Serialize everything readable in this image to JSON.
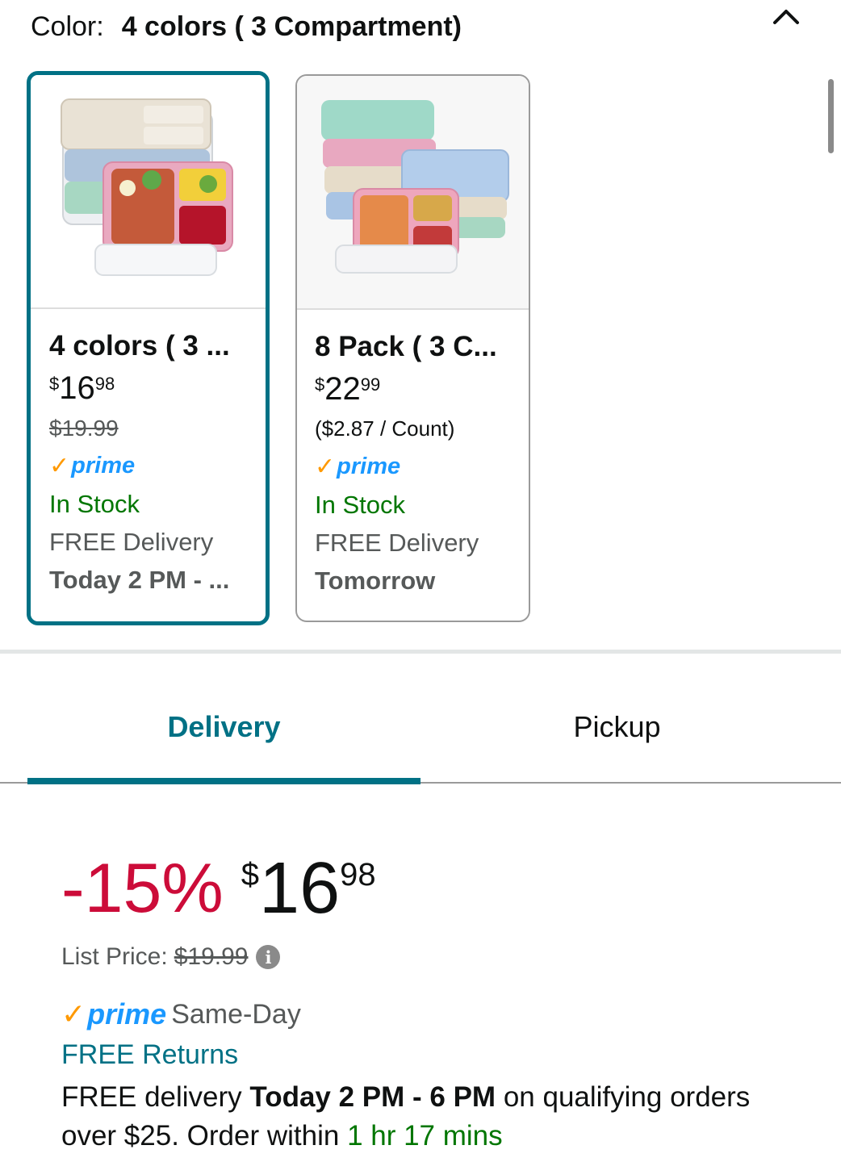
{
  "color_selector": {
    "label": "Color:",
    "selected_value": "4 colors ( 3 Compartment)",
    "collapse_icon": "chevron-up-icon"
  },
  "swatches": [
    {
      "title": "4 colors ( 3 ...",
      "price_currency": "$",
      "price_whole": "16",
      "price_fraction": "98",
      "secondary": "$19.99",
      "prime": "prime",
      "stock": "In Stock",
      "delivery_label": "FREE Delivery",
      "delivery_date": "Today 2 PM - ...",
      "selected": true
    },
    {
      "title": "8 Pack ( 3 C...",
      "price_currency": "$",
      "price_whole": "22",
      "price_fraction": "99",
      "secondary": "($2.87 / Count)",
      "prime": "prime",
      "stock": "In Stock",
      "delivery_label": "FREE Delivery",
      "delivery_date": "Tomorrow",
      "selected": false
    }
  ],
  "tabs": [
    {
      "label": "Delivery",
      "active": true
    },
    {
      "label": "Pickup",
      "active": false
    }
  ],
  "buybox": {
    "discount": "-15%",
    "currency": "$",
    "price_whole": "16",
    "price_fraction": "98",
    "list_price_label": "List Price:",
    "list_price_value": "$19.99",
    "prime_word": "prime",
    "prime_tier": "Same-Day",
    "returns": "FREE Returns",
    "delivery_prefix": "FREE delivery ",
    "delivery_window": "Today 2 PM - 6 PM",
    "delivery_middle": " on qualifying orders over $25. Order within ",
    "countdown": "1 hr 17 mins"
  },
  "colors": {
    "accent": "#007185",
    "prime_blue": "#1a98ff",
    "prime_check": "#ff9900",
    "in_stock": "#007600",
    "discount": "#cc0c39"
  }
}
